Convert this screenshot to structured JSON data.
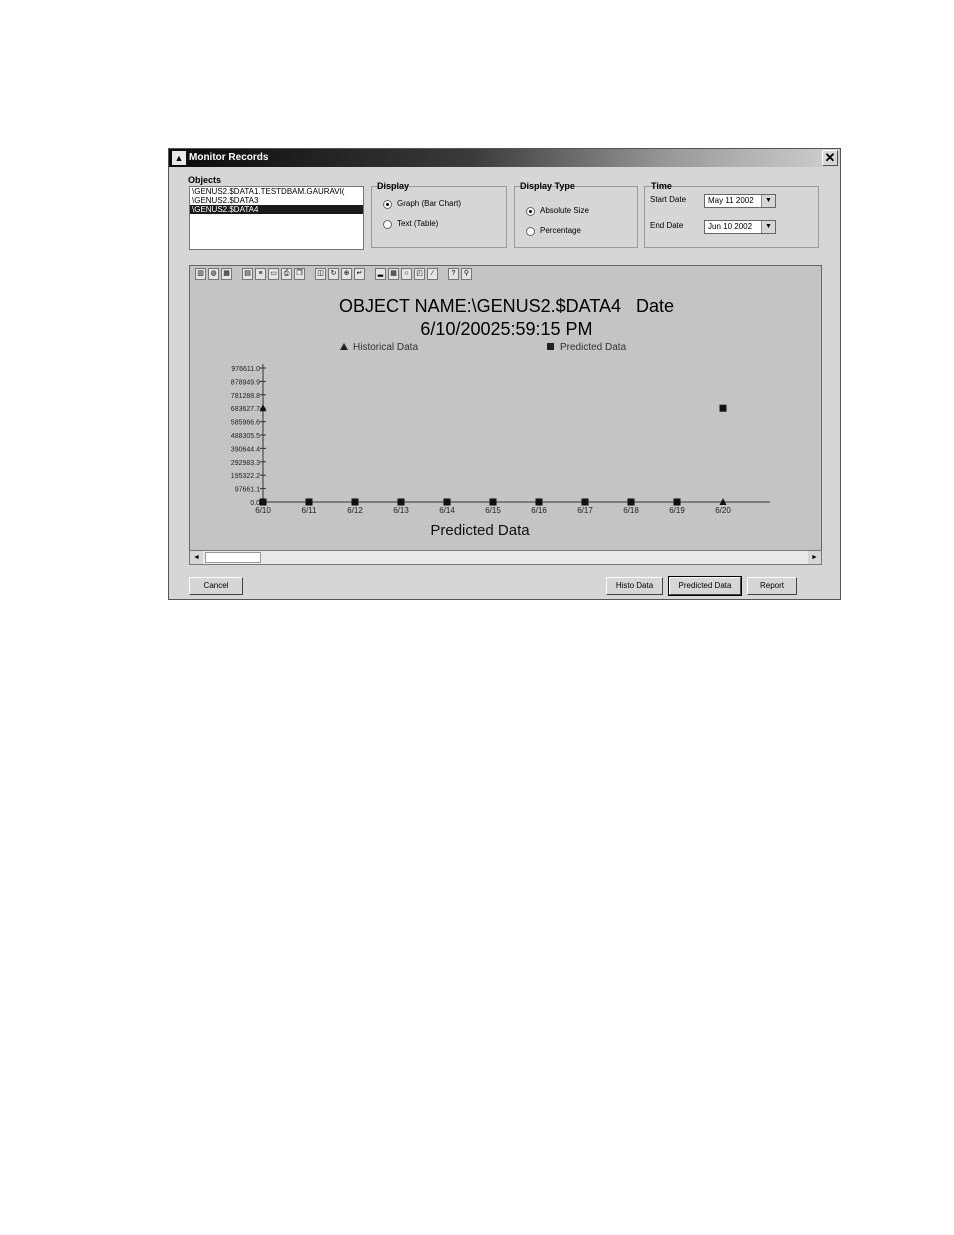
{
  "window": {
    "title": "Monitor Records",
    "close_label": "✕"
  },
  "objects": {
    "label": "Objects",
    "items": [
      "\\GENUS2.$DATA1.TESTDBAM.GAURAVI(",
      "\\GENUS2.$DATA3",
      "\\GENUS2.$DATA4"
    ],
    "selected_index": 2
  },
  "display": {
    "label": "Display",
    "options": [
      "Graph (Bar Chart)",
      "Text (Table)"
    ],
    "selected_index": 0
  },
  "display_type": {
    "label": "Display Type",
    "options": [
      "Absolute Size",
      "Percentage"
    ],
    "selected_index": 0
  },
  "time": {
    "label": "Time",
    "start_label": "Start Date",
    "start_value": "May 11 2002",
    "end_label": "End Date",
    "end_value": "Jun 10 2002"
  },
  "chart_title_line1": "OBJECT NAME:\\GENUS2.$DATA4   Date",
  "chart_title_line2": "6/10/20025:59:15 PM",
  "chart_data": {
    "type": "scatter",
    "title": "OBJECT NAME:\\GENUS2.$DATA4   Date 6/10/20025:59:15 PM",
    "xlabel": "Predicted Data",
    "ylabel": "",
    "categories": [
      "6/10",
      "6/11",
      "6/12",
      "6/13",
      "6/14",
      "6/15",
      "6/16",
      "6/17",
      "6/18",
      "6/19",
      "6/20"
    ],
    "yticks": [
      "976611.0",
      "878949.9",
      "781288.8",
      "683627.7",
      "585966.6",
      "488305.5",
      "390644.4",
      "292983.3",
      "195322.2",
      "97661.1",
      "0.0"
    ],
    "ylim": [
      0,
      976611
    ],
    "legend_position": "top",
    "series": [
      {
        "name": "Historical Data",
        "marker": "triangle",
        "values": [
          683627.7,
          null,
          null,
          null,
          null,
          null,
          null,
          null,
          null,
          null,
          0
        ]
      },
      {
        "name": "Predicted Data",
        "marker": "square",
        "values": [
          0,
          0,
          0,
          0,
          0,
          0,
          0,
          0,
          0,
          0,
          683627.7
        ]
      }
    ]
  },
  "buttons": {
    "cancel": "Cancel",
    "histo": "Histo Data",
    "predicted": "Predicted Data",
    "report": "Report"
  }
}
